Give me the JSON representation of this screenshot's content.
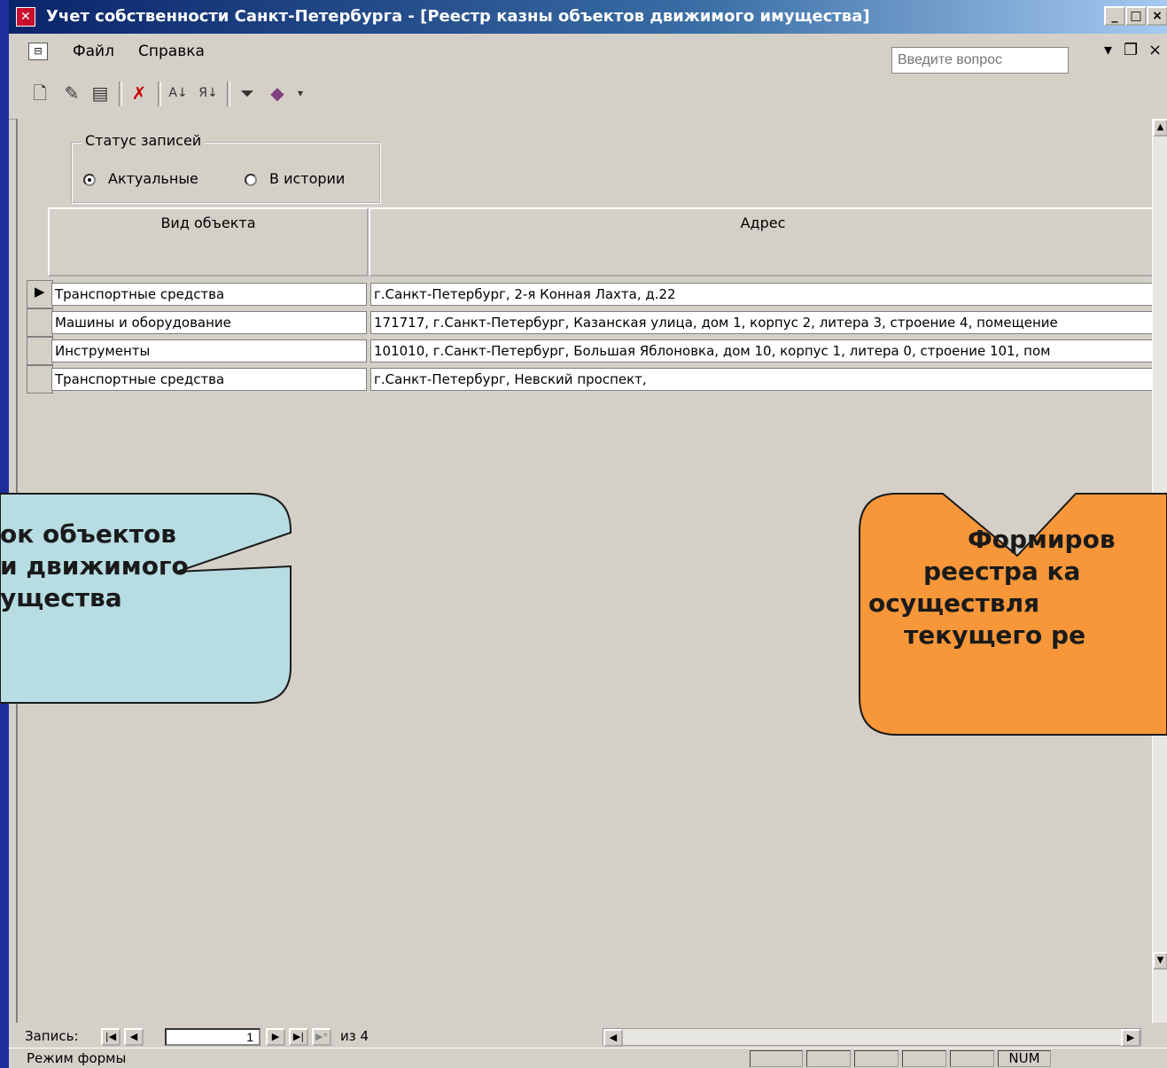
{
  "window": {
    "title": "Учет собственности Санкт-Петербурга  - [Реестр казны объектов движимого имущества]"
  },
  "menu": {
    "items": [
      "Файл",
      "Справка"
    ],
    "ask_placeholder": "Введите вопрос"
  },
  "toolbar": {
    "icons": [
      "new-record-icon",
      "edit-icon",
      "properties-icon",
      "delete-icon",
      "sort-asc-icon",
      "sort-desc-icon",
      "filter-icon",
      "report-icon"
    ]
  },
  "status_group": {
    "legend": "Статус записей",
    "options": [
      "Актуальные",
      "В истории"
    ],
    "selected": "Актуальные"
  },
  "table": {
    "columns": [
      "Вид объекта",
      "Адрес"
    ],
    "rows": [
      {
        "kind": "Транспортные средства",
        "address": "г.Санкт-Петербург,   2-я Конная Лахта, д.22"
      },
      {
        "kind": "Машины и оборудование",
        "address": "171717, г.Санкт-Петербург, Казанская улица, дом 1, корпус 2, литера 3, строение 4, помещение"
      },
      {
        "kind": "Инструменты",
        "address": "101010, г.Санкт-Петербург,   Большая Яблоновка, дом 10, корпус 1, литера 0, строение 101, пом"
      },
      {
        "kind": "Транспортные средства",
        "address": "г.Санкт-Петербург, Невский проспект,"
      }
    ],
    "current_row": 1
  },
  "navigation": {
    "label": "Запись:",
    "current": "1",
    "total_text": "из  4"
  },
  "statusbar": {
    "mode": "Режим формы",
    "num": "NUM"
  },
  "callouts": {
    "left": [
      "ок объектов",
      "и движимого",
      "ущества"
    ],
    "right": [
      "Формиров",
      "реестра ка",
      "осуществля",
      "текущего ре"
    ],
    "left_color": "#b7dde3",
    "right_color": "#f7973a"
  },
  "colors": {
    "background": "#1e2f9c",
    "window": "#d4d0c8",
    "titlebar": "#0a246a"
  }
}
